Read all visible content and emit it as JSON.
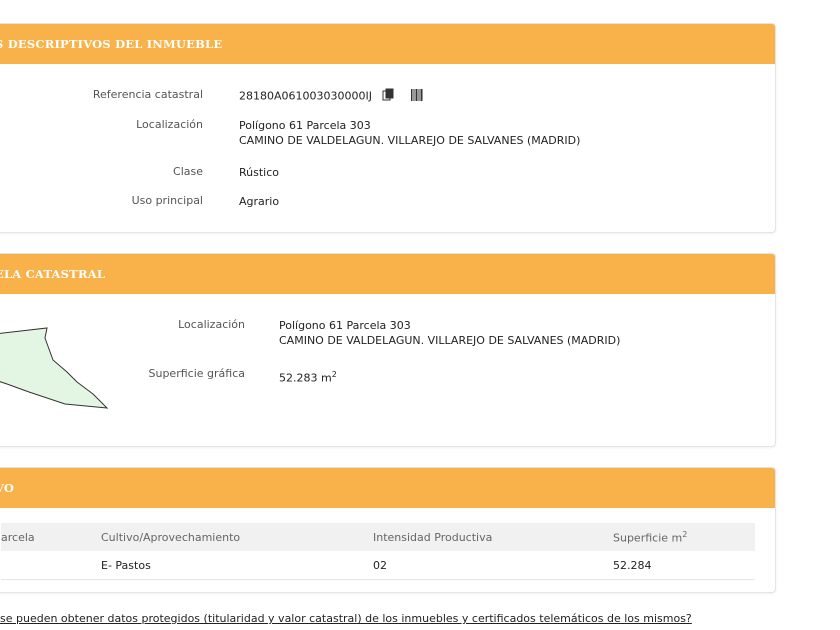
{
  "inmueble": {
    "title": "S DESCRIPTIVOS DEL INMUEBLE",
    "rows": [
      {
        "label": "Referencia catastral",
        "value": "28180A061003030000IJ"
      },
      {
        "label": "Localización",
        "value": "Polígono 61 Parcela 303",
        "value2": "CAMINO DE VALDELAGUN. VILLAREJO DE SALVANES (MADRID)"
      },
      {
        "label": "Clase",
        "value": "Rústico"
      },
      {
        "label": "Uso principal",
        "value": "Agrario"
      }
    ],
    "icons": [
      "copy-icon",
      "barcode-icon"
    ]
  },
  "parcela": {
    "title": "ELA CATASTRAL",
    "localizacion_label": "Localización",
    "localizacion_value": "Polígono 61 Parcela 303",
    "localizacion_value2": "CAMINO DE VALDELAGUN. VILLAREJO DE SALVANES (MADRID)",
    "superficie_label": "Superficie gráfica",
    "superficie_value": "52.283 m",
    "superficie_unit_sup": "2"
  },
  "cultivo": {
    "title": "VO",
    "columns": [
      "arcela",
      "Cultivo/Aprovechamiento",
      "Intensidad Productiva",
      "Superficie m",
      "2"
    ],
    "rows": [
      {
        "subparcela": "",
        "cultivo": "E- Pastos",
        "intensidad": "02",
        "superficie": "52.284"
      }
    ]
  },
  "footer": {
    "link_text": "se pueden obtener datos protegidos (titularidad y valor catastral) de los inmuebles y certificados telemáticos de los mismos?"
  },
  "colors": {
    "header_bg": "#f9b24a",
    "parcel_fill": "#e3f5e3",
    "parcel_stroke": "#333333"
  }
}
